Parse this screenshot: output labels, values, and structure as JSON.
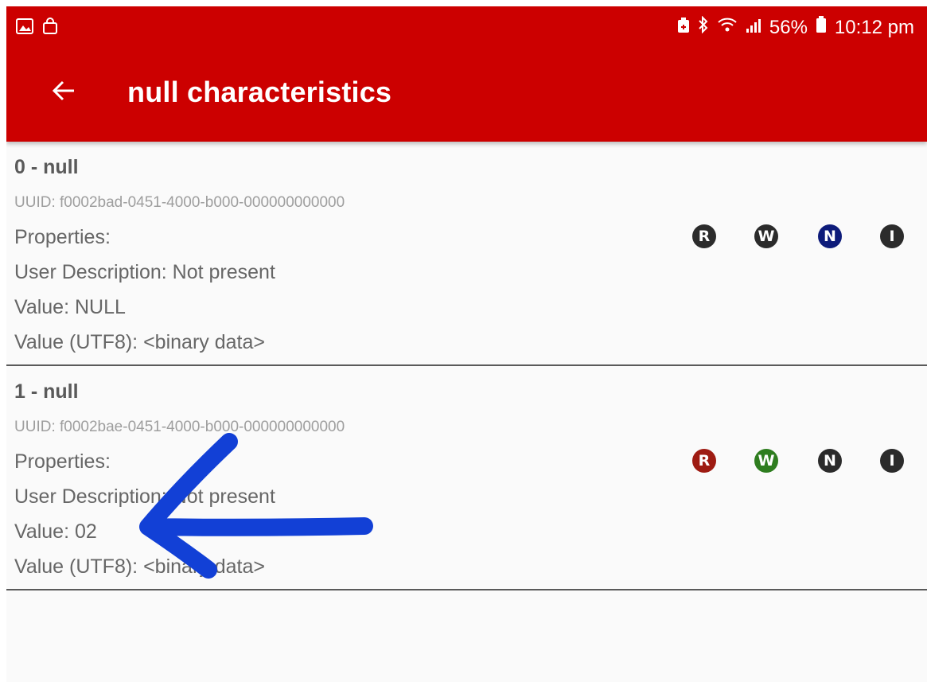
{
  "status_bar": {
    "battery": "56%",
    "time": "10:12 pm",
    "left_icons": [
      "gallery-icon",
      "shopping-bag-icon"
    ],
    "right_icons": [
      "battery-saver-icon",
      "bluetooth-icon",
      "wifi-icon",
      "signal-icon",
      "battery-icon"
    ]
  },
  "app_bar": {
    "title": "null characteristics",
    "back_icon": "arrow-left-icon",
    "background": "#cc0000"
  },
  "characteristics": [
    {
      "name": "0 - null",
      "uuid": "UUID: f0002bad-0451-4000-b000-000000000000",
      "properties": "Properties:",
      "user_description": "User Description: Not present",
      "value": "Value: NULL",
      "value_utf8": "Value (UTF8): <binary data>",
      "badges": [
        {
          "label": "R",
          "color": "#2b2b2b"
        },
        {
          "label": "W",
          "color": "#2b2b2b"
        },
        {
          "label": "N",
          "color": "#0d1b7a"
        },
        {
          "label": "I",
          "color": "#2b2b2b"
        }
      ]
    },
    {
      "name": "1 - null",
      "uuid": "UUID: f0002bae-0451-4000-b000-000000000000",
      "properties": "Properties:",
      "user_description": "User Description: Not present",
      "value": "Value: 02",
      "value_utf8": "Value (UTF8): <binary data>",
      "badges": [
        {
          "label": "R",
          "color": "#9e1b12"
        },
        {
          "label": "W",
          "color": "#2e7d1f"
        },
        {
          "label": "N",
          "color": "#2b2b2b"
        },
        {
          "label": "I",
          "color": "#2b2b2b"
        }
      ]
    }
  ],
  "annotation": {
    "icon": "hand-drawn-arrow-icon",
    "color": "#1240d6"
  }
}
